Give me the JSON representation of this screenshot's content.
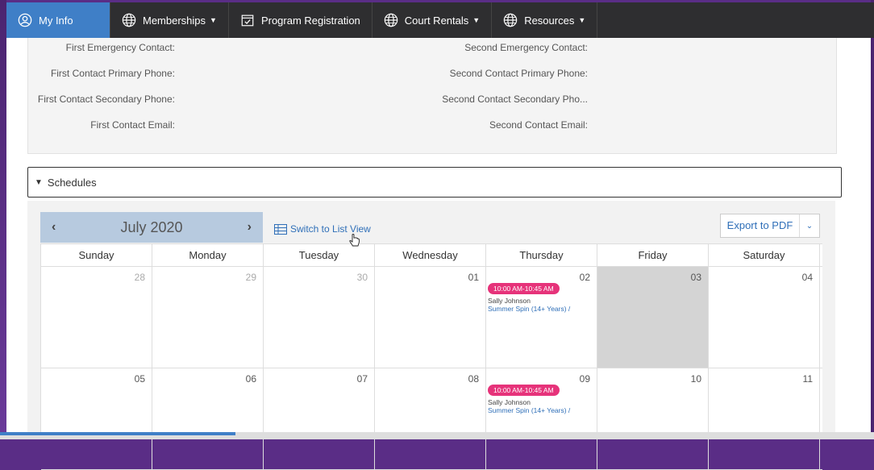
{
  "nav": {
    "items": [
      {
        "label": "My Info",
        "icon": "user-circle-icon",
        "caret": false
      },
      {
        "label": "Memberships",
        "icon": "globe-icon",
        "caret": true
      },
      {
        "label": "Program Registration",
        "icon": "calendar-check-icon",
        "caret": false
      },
      {
        "label": "Court Rentals",
        "icon": "globe-icon",
        "caret": true
      },
      {
        "label": "Resources",
        "icon": "globe-icon",
        "caret": true
      }
    ]
  },
  "contacts": {
    "first_emergency": "First Emergency Contact:",
    "first_primary": "First Contact Primary Phone:",
    "first_secondary": "First Contact Secondary Phone:",
    "first_email": "First Contact Email:",
    "second_emergency": "Second Emergency Contact:",
    "second_primary": "Second Contact Primary Phone:",
    "second_secondary": "Second Contact Secondary Pho...",
    "second_email": "Second Contact Email:"
  },
  "schedules": {
    "label": "Schedules",
    "month": "July 2020",
    "prev_arrow": "‹",
    "next_arrow": "›",
    "list_view_label": "Switch to List View",
    "export_label": "Export to PDF",
    "weekdays": [
      "Sunday",
      "Monday",
      "Tuesday",
      "Wednesday",
      "Thursday",
      "Friday",
      "Saturday"
    ],
    "week1": [
      "28",
      "29",
      "30",
      "01",
      "02",
      "03",
      "04"
    ],
    "week2": [
      "05",
      "06",
      "07",
      "08",
      "09",
      "10",
      "11"
    ],
    "event": {
      "time": "10:00 AM-10:45 AM",
      "person": "Sally Johnson",
      "program": "Summer Spin (14+ Years) /"
    }
  },
  "colors": {
    "nav_bg": "#2e2e30",
    "nav_active": "#3f7fc7",
    "event_badge": "#e6337a",
    "link": "#2f6fb8",
    "today_bg": "#d4d4d4"
  }
}
